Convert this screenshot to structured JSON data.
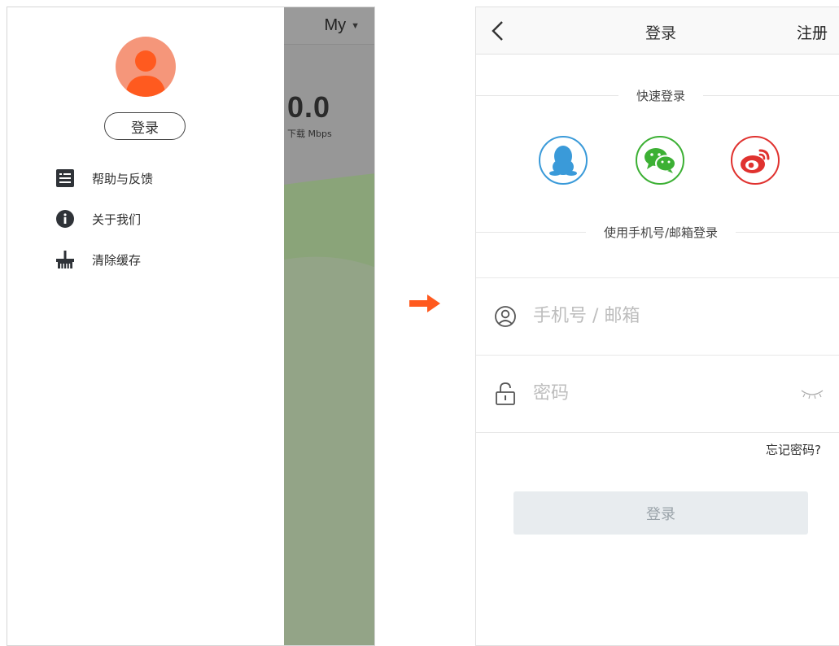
{
  "left_screen": {
    "header_title": "My",
    "download_value": "0.0",
    "download_unit": "下载 Mbps",
    "login_button": "登录",
    "menu": [
      {
        "label": "帮助与反馈",
        "icon": "feedback-list-icon"
      },
      {
        "label": "关于我们",
        "icon": "info-icon"
      },
      {
        "label": "清除缓存",
        "icon": "broom-icon"
      }
    ]
  },
  "right_screen": {
    "title": "登录",
    "register": "注册",
    "quick_login_label": "快速登录",
    "social": [
      {
        "name": "qq",
        "icon": "qq-penguin-icon",
        "color": "#3a9ad9"
      },
      {
        "name": "wechat",
        "icon": "wechat-icon",
        "color": "#3cb034"
      },
      {
        "name": "weibo",
        "icon": "weibo-icon",
        "color": "#e0322f"
      }
    ],
    "phone_email_label": "使用手机号/邮箱登录",
    "account_placeholder": "手机号 / 邮箱",
    "password_placeholder": "密码",
    "forgot_password": "忘记密码?",
    "submit": "登录"
  },
  "colors": {
    "accent_orange": "#ff5a1f",
    "avatar_bg": "#f5967a",
    "avatar_figure": "#ff5a1f",
    "dim_overlay": "#979797",
    "wave_green": "#93b57a"
  }
}
